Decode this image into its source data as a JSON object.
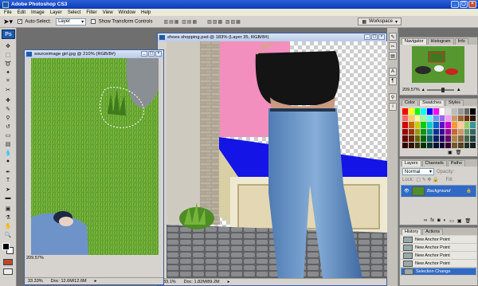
{
  "app": {
    "title": "Adobe Photoshop CS3",
    "logo": "Ps"
  },
  "menu": [
    "File",
    "Edit",
    "Image",
    "Layer",
    "Select",
    "Filter",
    "View",
    "Window",
    "Help"
  ],
  "options": {
    "auto_select_label": "Auto-Select:",
    "auto_select_value": "Layer",
    "transform_label": "Show Transform Controls",
    "workspace": "Workspace"
  },
  "doc1": {
    "title": "sourceimage girl.jpg @ 210% (RGB/8#)",
    "zoom": "209.57%",
    "status_zoom": "33.33%",
    "doc_size": "Doc: 12.6M/12.6M"
  },
  "doc2": {
    "title": "shoes shopping.psd @ 183% (Layer 35, RGB/8#)",
    "status_zoom": "183.1%",
    "doc_size": "Doc: 1.82M/89.2M"
  },
  "navigator": {
    "tabs": [
      "Navigator",
      "Histogram",
      "Info"
    ],
    "zoom": "209.57%"
  },
  "color": {
    "tabs": [
      "Color",
      "Swatches",
      "Styles"
    ],
    "active": "Swatches"
  },
  "layers": {
    "tabs": [
      "Layers",
      "Channels",
      "Paths"
    ],
    "blend_mode": "Normal",
    "opacity_label": "Opacity:",
    "lock_label": "Lock:",
    "fill_label": "Fill:",
    "layer_name": "Background"
  },
  "history": {
    "tabs": [
      "History",
      "Actions"
    ],
    "items": [
      "New Anchor Point",
      "New Anchor Point",
      "New Anchor Point",
      "New Anchor Point",
      "Selection Change"
    ]
  },
  "colors": {
    "accent": "#316ac5",
    "titlebar": "#0a3ab8"
  }
}
